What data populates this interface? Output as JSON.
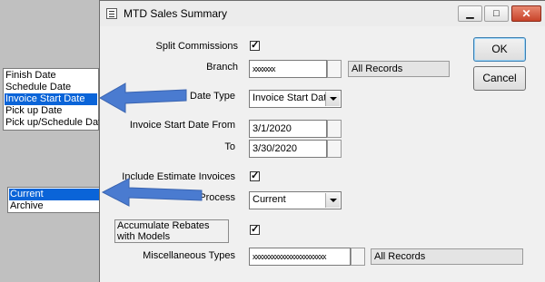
{
  "window": {
    "title": "MTD Sales Summary",
    "controls": {
      "minimize": "▁",
      "maximize": "□",
      "close": "✕"
    }
  },
  "date_type_list": {
    "items": [
      "Finish Date",
      "Schedule Date",
      "Invoice Start Date",
      "Pick up Date",
      "Pick up/Schedule Date"
    ],
    "selected": "Invoice Start Date"
  },
  "process_list": {
    "items": [
      "Current",
      "Archive"
    ],
    "selected": "Current"
  },
  "form": {
    "split_commissions": {
      "label": "Split Commissions",
      "checked": true,
      "mark": "✓"
    },
    "branch": {
      "label": "Branch",
      "value": "xxxxxxx",
      "records": "All Records"
    },
    "date_type": {
      "label": "Date Type",
      "value": "Invoice Start Date"
    },
    "invoice_start_from": {
      "label": "Invoice Start Date From",
      "value": "3/1/2020"
    },
    "invoice_start_to": {
      "label": "To",
      "value": "3/30/2020"
    },
    "include_estimates": {
      "label": "Include Estimate Invoices",
      "checked": true,
      "mark": "✓"
    },
    "process": {
      "label": "Process",
      "value": "Current"
    },
    "accumulate_rebates": {
      "label": "Accumulate Rebates with Models",
      "checked": true,
      "mark": "✓"
    },
    "misc_types": {
      "label": "Miscellaneous Types",
      "value": "xxxxxxxxxxxxxxxxxxxxxxx",
      "records": "All Records"
    }
  },
  "buttons": {
    "ok": "OK",
    "cancel": "Cancel"
  },
  "colors": {
    "selection": "#0a64d8",
    "arrow": "#4a7bd0",
    "desktop": "#c0c0c0"
  },
  "icons": [
    "app-icon",
    "minimize-icon",
    "maximize-icon",
    "close-icon",
    "dropdown-arrow-icon",
    "checkmark-icon",
    "callout-arrow-icon"
  ]
}
